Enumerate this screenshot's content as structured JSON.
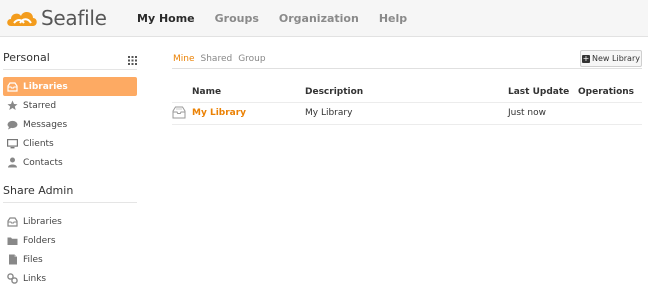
{
  "brand": {
    "name": "Seafile"
  },
  "nav": {
    "items": [
      {
        "label": "My Home",
        "active": true
      },
      {
        "label": "Groups",
        "active": false
      },
      {
        "label": "Organization",
        "active": false
      },
      {
        "label": "Help",
        "active": false
      }
    ]
  },
  "sidebar": {
    "personal_title": "Personal",
    "personal_items": [
      {
        "label": "Libraries",
        "icon": "libraries-icon",
        "active": true
      },
      {
        "label": "Starred",
        "icon": "star-icon",
        "active": false
      },
      {
        "label": "Messages",
        "icon": "message-icon",
        "active": false
      },
      {
        "label": "Clients",
        "icon": "monitor-icon",
        "active": false
      },
      {
        "label": "Contacts",
        "icon": "user-icon",
        "active": false
      }
    ],
    "share_admin_title": "Share Admin",
    "share_admin_items": [
      {
        "label": "Libraries",
        "icon": "libraries-icon"
      },
      {
        "label": "Folders",
        "icon": "folder-icon"
      },
      {
        "label": "Files",
        "icon": "file-icon"
      },
      {
        "label": "Links",
        "icon": "link-icon"
      }
    ]
  },
  "main": {
    "tabs": [
      {
        "label": "Mine",
        "active": true
      },
      {
        "label": "Shared",
        "active": false
      },
      {
        "label": "Group",
        "active": false
      }
    ],
    "new_library_label": "New Library",
    "table": {
      "headers": [
        "Name",
        "Description",
        "Last Update",
        "Operations"
      ],
      "rows": [
        {
          "name": "My Library",
          "description": "My Library",
          "last_update": "Just now",
          "operations": ""
        }
      ]
    }
  },
  "colors": {
    "accent": "#eb8205",
    "active_sidebar_bg": "#fdaa63",
    "header_bg": "#f6f6f6"
  }
}
